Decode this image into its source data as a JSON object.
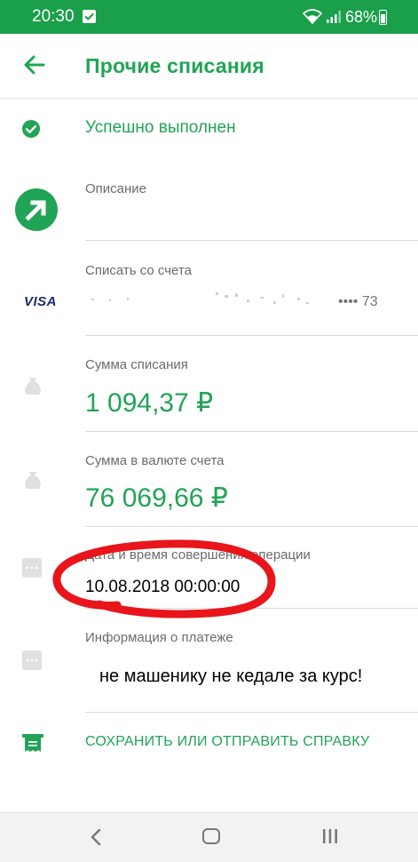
{
  "status_bar": {
    "time": "20:30",
    "battery": "68%",
    "battery_level": 0.68
  },
  "header": {
    "title": "Прочие списания"
  },
  "status": {
    "text": "Успешно выполнен"
  },
  "description": {
    "label": "Описание"
  },
  "account": {
    "label": "Списать со счета",
    "card_brand": "VISA",
    "masked_number": "•••• 73"
  },
  "amount": {
    "label": "Сумма списания",
    "value": "1 094,37 ₽"
  },
  "amount_account_currency": {
    "label": "Сумма в валюте счета",
    "value": "76 069,66 ₽"
  },
  "datetime": {
    "label": "Дата и время совершения операции",
    "value": "10.08.2018 00:00:00"
  },
  "payment_info": {
    "label": "Информация о платеже",
    "value": "не машенику не кедале за курс!"
  },
  "actions": {
    "save_label": "СОХРАНИТЬ ИЛИ ОТПРАВИТЬ СПРАВКУ"
  },
  "colors": {
    "brand_green": "#21a455",
    "status_bar": "#1a9f4a",
    "annotation_red": "#e8151b"
  },
  "icons": {
    "back": "arrow-left-icon",
    "status": "check-circle-icon",
    "description": "arrow-up-right-icon",
    "account": "visa-logo",
    "amount": "money-bag-icon",
    "datetime": "calendar-icon",
    "payment_info": "message-icon",
    "save": "receipt-icon"
  }
}
